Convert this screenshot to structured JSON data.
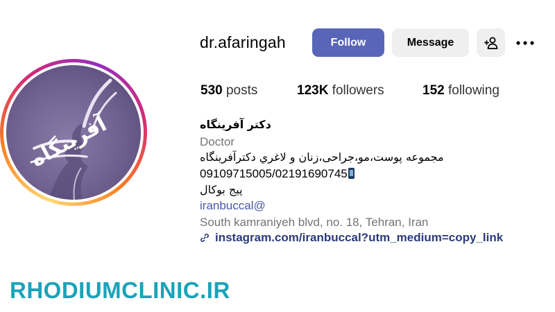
{
  "profile": {
    "username": "dr.afaringah",
    "avatar_text": "آفرینگاه"
  },
  "actions": {
    "follow_label": "Follow",
    "message_label": "Message",
    "add_user_icon": "add-user-icon",
    "more_icon": "more-horizontal-icon"
  },
  "stats": {
    "posts_count": "530",
    "posts_label": "posts",
    "followers_count": "123K",
    "followers_label": "followers",
    "following_count": "152",
    "following_label": "following"
  },
  "bio": {
    "full_name": "دکتر آفرینگاه",
    "category": "Doctor",
    "line1": "مجموعه پوست،مو،جراحی،زنان و لاغري دکترآفرینگاه",
    "phones": "09109715005/02191690745",
    "line3": "پیج بوکال",
    "mention": "iranbuccal@",
    "address": "South kamraniyeh blvd, no. 18, Tehran, Iran",
    "link": "instagram.com/iranbuccal?utm_medium=copy_link"
  },
  "colors": {
    "follow_button": "#5865b8",
    "secondary_button": "#efefef",
    "mention": "#4a57a8",
    "link": "#2b3a7a",
    "watermark": "#1aa3b8"
  },
  "watermark": "RHODIUMCLINIC.IR"
}
